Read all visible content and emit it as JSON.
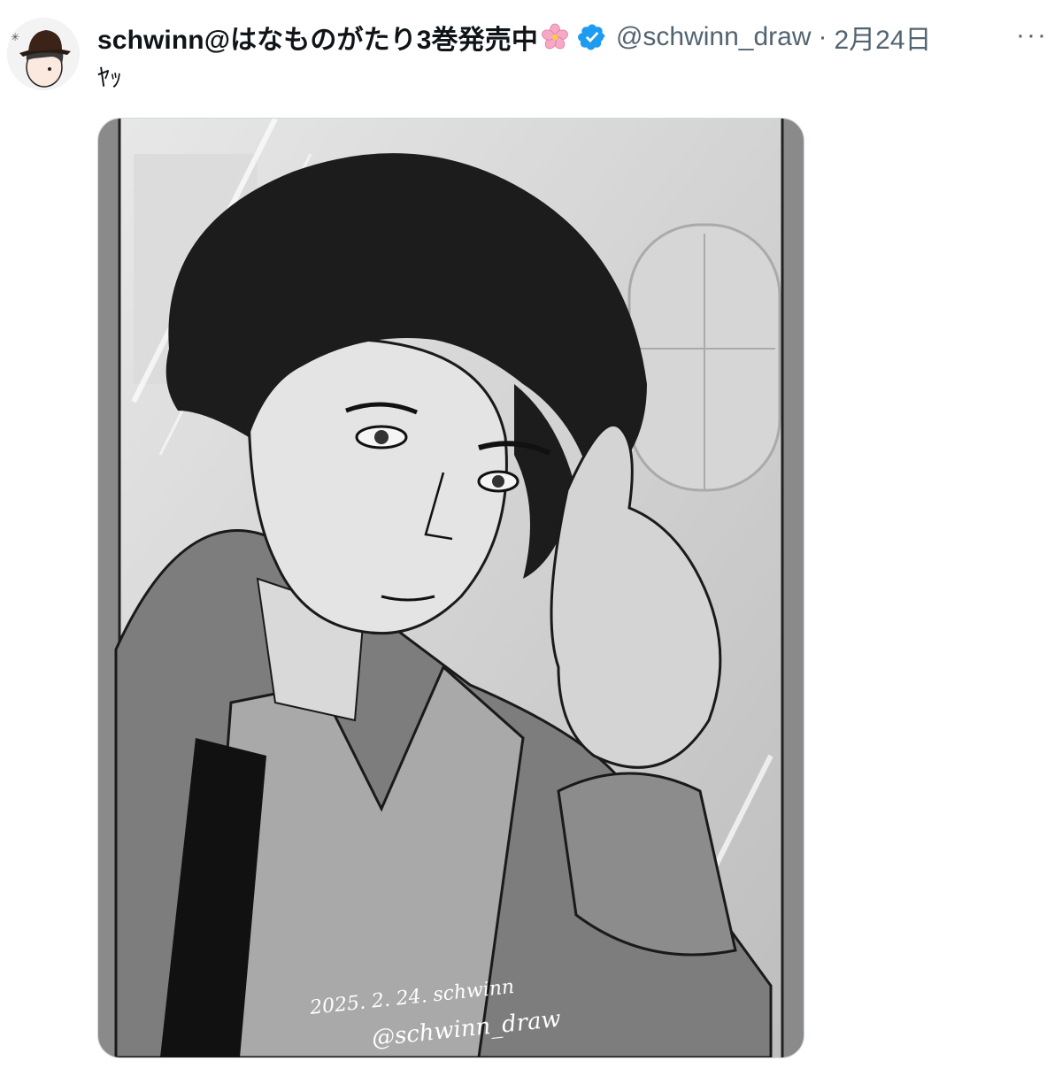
{
  "tweet": {
    "display_name": "schwinn@はなものがたり3巻発売中",
    "handle": "@schwinn_draw",
    "separator": "·",
    "date": "2月24日",
    "more_label": "···",
    "text": "ﾔｯ",
    "verified": true
  },
  "media": {
    "signature_line1": "2025. 2. 24. schwinn",
    "signature_line2": "@schwinn_draw"
  },
  "icons": {
    "flower": "cherry-blossom-icon",
    "verified": "verified-badge-icon",
    "more": "more-options-icon"
  },
  "colors": {
    "text_primary": "#0f1419",
    "text_secondary": "#536471",
    "verified_blue": "#1d9bf0",
    "blossom_pink": "#f7a8c4"
  }
}
